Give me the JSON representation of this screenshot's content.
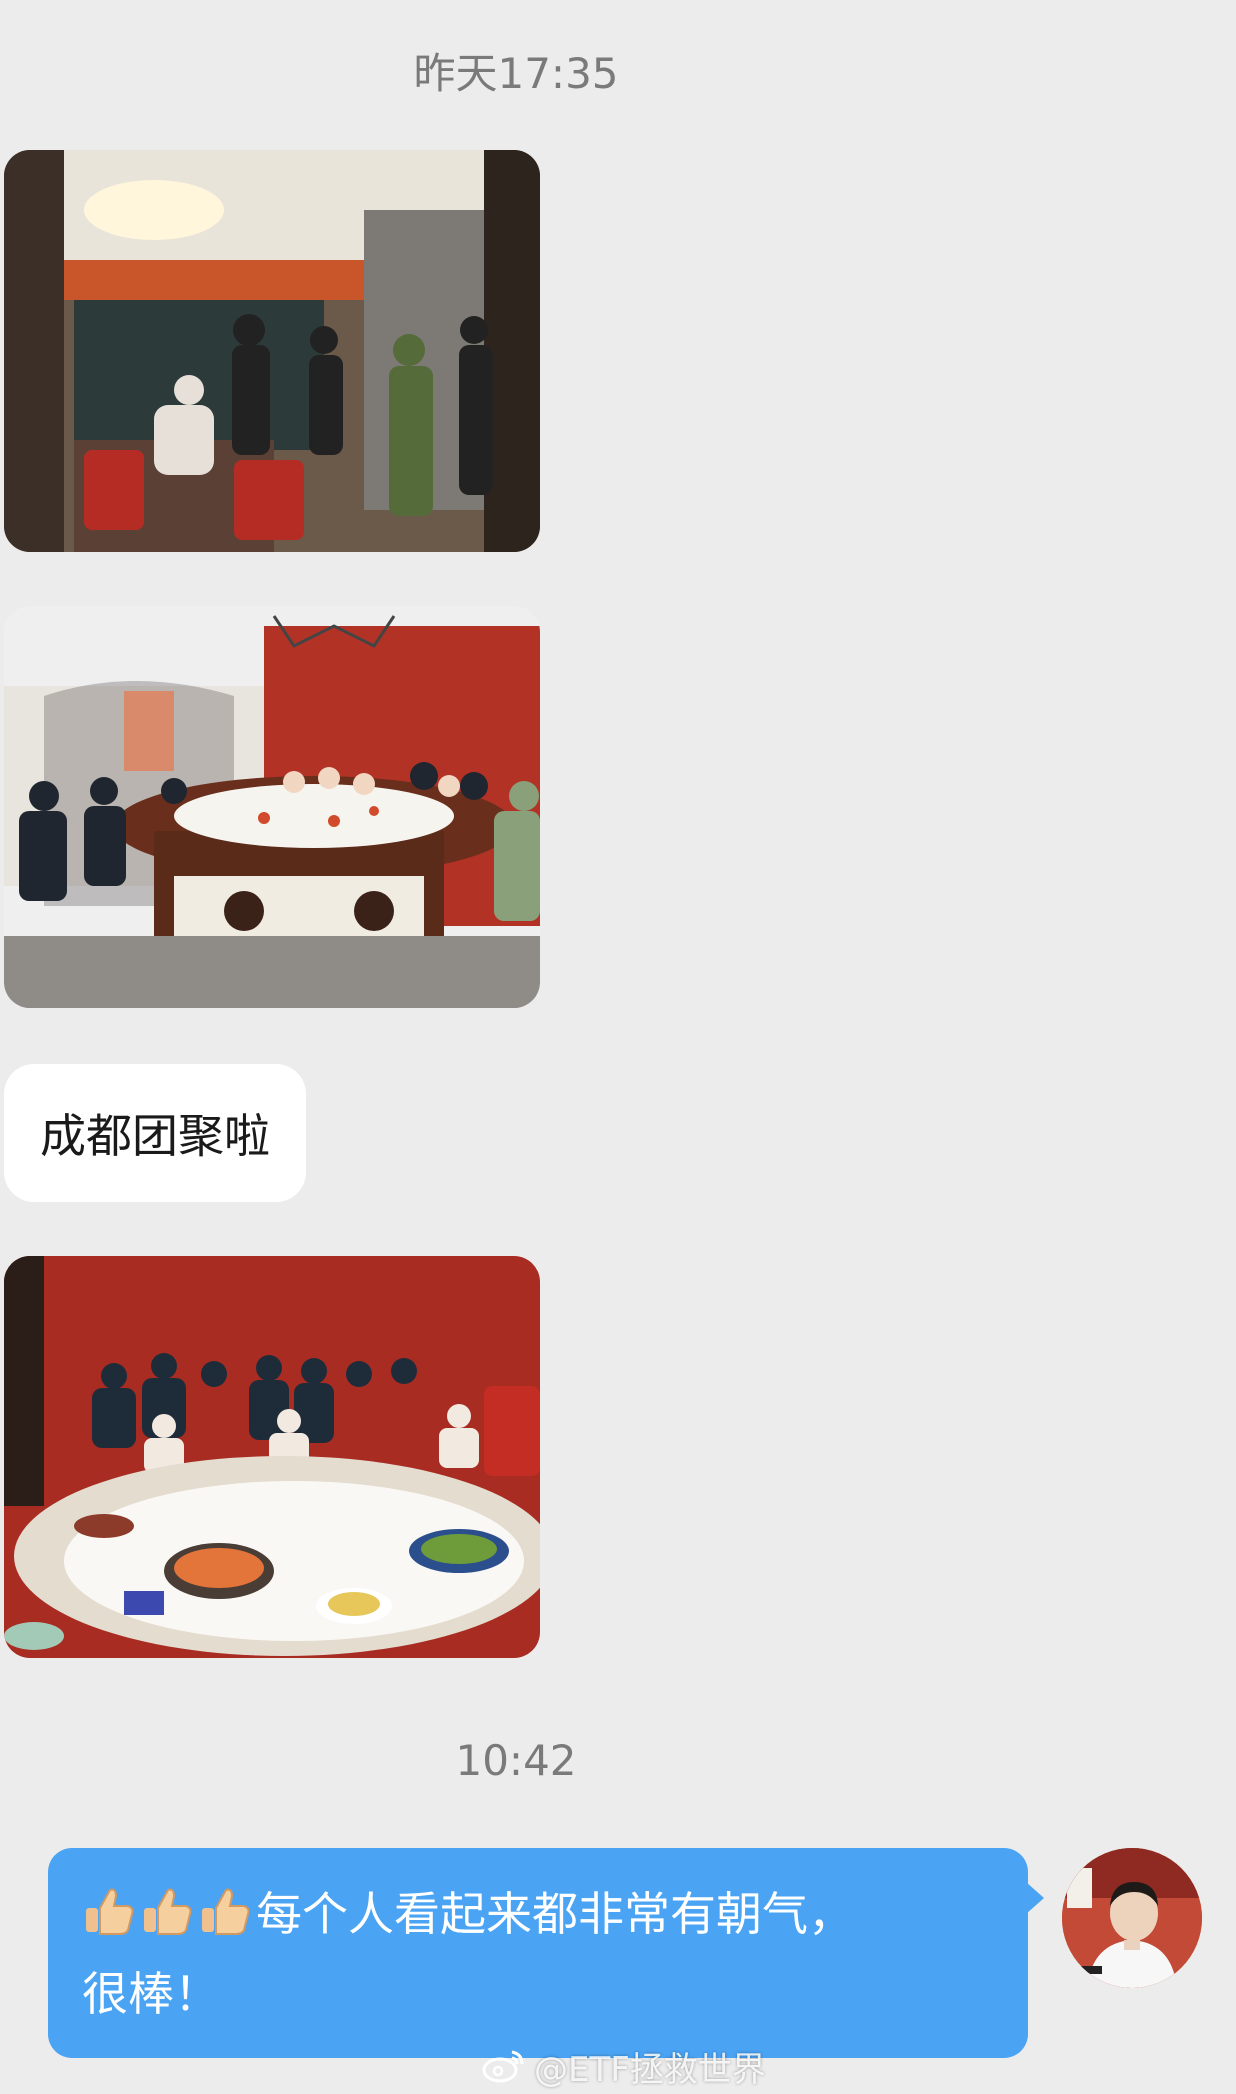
{
  "messages": {
    "timestamp_1": "昨天17:35",
    "text_in": "成都团聚啦",
    "timestamp_2": "10:42",
    "text_out_line1": "每个人看起来都非常有朝气，",
    "text_out_line2": "很棒！",
    "emojis": [
      "thumbs-up-icon",
      "thumbs-up-icon",
      "thumbs-up-icon"
    ]
  },
  "watermark": {
    "text": "@ETF拯救世界"
  },
  "colors": {
    "background": "#ececec",
    "outgoing_bubble": "#4aa3f3",
    "incoming_bubble": "#ffffff",
    "timestamp": "#7a7a7a"
  }
}
